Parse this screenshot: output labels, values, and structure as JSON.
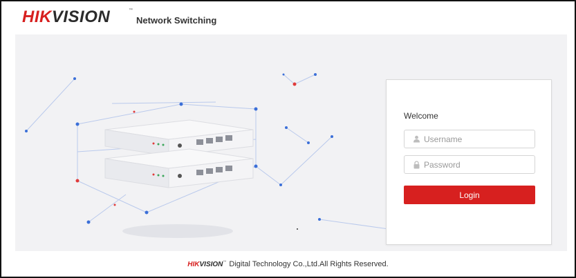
{
  "brand": {
    "logo_red": "HIK",
    "logo_dark": "VISION",
    "trademark": "™",
    "product": "Network Switching",
    "accent_color": "#d7201f"
  },
  "login": {
    "welcome": "Welcome",
    "username_placeholder": "Username",
    "password_placeholder": "Password",
    "login_label": "Login",
    "user_icon": "user-icon",
    "lock_icon": "lock-icon"
  },
  "footer": {
    "logo_red": "HIK",
    "logo_dark": "VISION",
    "trademark": "™",
    "text": "Digital Technology Co.,Ltd.All Rights Reserved."
  }
}
